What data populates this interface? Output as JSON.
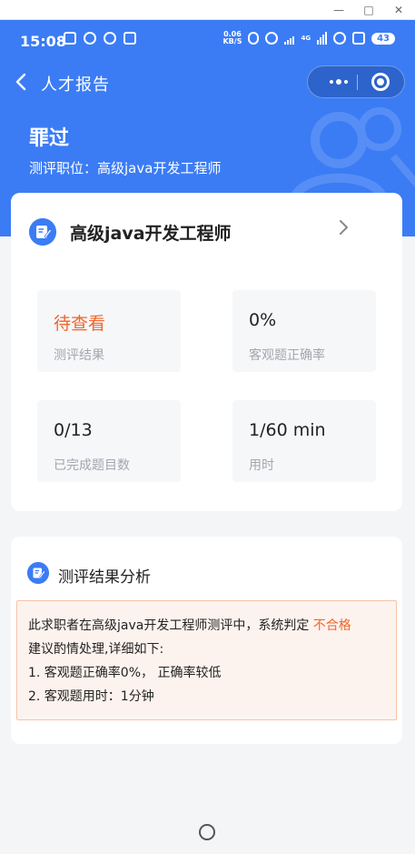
{
  "window": {
    "minimize_glyph": "—",
    "maximize_glyph": "□",
    "close_glyph": "✕"
  },
  "status_bar": {
    "time": "15:08",
    "net_speed_top": "0.06",
    "net_speed_bottom": "KB/S",
    "signal_label": "4G",
    "battery": "43"
  },
  "nav": {
    "title": "人才报告"
  },
  "header": {
    "name": "罪过",
    "position_prefix": "测评职位：",
    "position_value": "高级java开发工程师"
  },
  "summary_card": {
    "title": "高级java开发工程师",
    "stats": [
      {
        "value": "待查看",
        "label": "测评结果"
      },
      {
        "value": "0%",
        "label": "客观题正确率"
      },
      {
        "value": "0/13",
        "label": "已完成题目数"
      },
      {
        "value": "1/60 min",
        "label": "用时"
      }
    ]
  },
  "analysis_card": {
    "title": "测评结果分析",
    "line1_prefix": "此求职者在高级java开发工程师测评中，系统判定",
    "verdict": "不合格",
    "line2": "建议酌情处理,详细如下:",
    "line3": "1. 客观题正确率0%， 正确率较低",
    "line4": "2. 客观题用时：1分钟"
  },
  "colors": {
    "primary": "#3b7cf5",
    "accent_orange": "#f0662c"
  },
  "icons": [
    "back-icon",
    "more-icon",
    "close-capsule-icon",
    "edit-note-icon",
    "chevron-right-icon",
    "home-indicator-icon"
  ]
}
